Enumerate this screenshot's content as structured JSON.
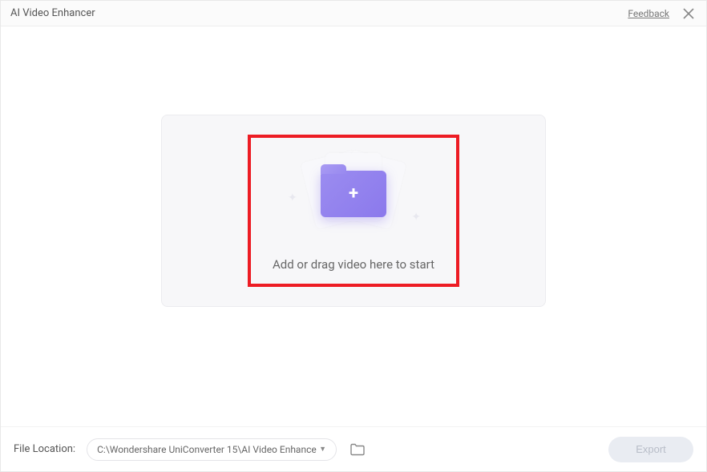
{
  "header": {
    "title": "AI Video Enhancer",
    "feedback_label": "Feedback"
  },
  "dropzone": {
    "instruction": "Add or drag video here to start"
  },
  "footer": {
    "location_label": "File Location:",
    "path": "C:\\Wondershare UniConverter 15\\AI Video Enhance",
    "export_label": "Export"
  },
  "colors": {
    "accent": "#8b79ec",
    "highlight_border": "#ed1c24"
  }
}
